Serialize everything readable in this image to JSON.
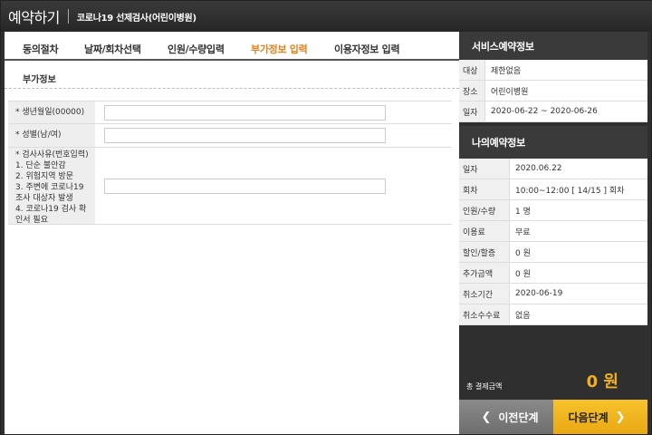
{
  "header": {
    "title": "예약하기",
    "subtitle": "코로나19 선제검사(어린이병원)"
  },
  "tabs": [
    {
      "label": "동의절차",
      "active": false
    },
    {
      "label": "날짜/회차선택",
      "active": false
    },
    {
      "label": "인원/수량입력",
      "active": false
    },
    {
      "label": "부가정보 입력",
      "active": true
    },
    {
      "label": "이용자정보 입력",
      "active": false
    }
  ],
  "section": {
    "title": "부가정보"
  },
  "form": {
    "fields": [
      {
        "label": "* 생년월일(00000)",
        "value": ""
      },
      {
        "label": "* 성별(남/여)",
        "value": ""
      },
      {
        "label": "* 검사사유(번호입력)\n1. 단순 불안감\n2. 위험지역 방문\n3. 주변에 코로나19 조사 대상자 발생\n4. 코로나19 검사 확인서 필요",
        "value": ""
      }
    ]
  },
  "service_info": {
    "heading": "서비스예약정보",
    "rows": [
      {
        "key": "대상",
        "value": "제한없음"
      },
      {
        "key": "장소",
        "value": "어린이병원"
      },
      {
        "key": "일자",
        "value": "2020-06-22 ~ 2020-06-26"
      }
    ]
  },
  "my_info": {
    "heading": "나의예약정보",
    "rows": [
      {
        "key": "일자",
        "value": "2020.06.22"
      },
      {
        "key": "회차",
        "value": "10:00~12:00 [ 14/15 ] 회차"
      },
      {
        "key": "인원/수량",
        "value": "1 명"
      },
      {
        "key": "이용료",
        "value": "무료"
      },
      {
        "key": "할인/할증",
        "value": "0 원"
      },
      {
        "key": "추가금액",
        "value": "0 원"
      },
      {
        "key": "취소기간",
        "value": "2020-06-19"
      },
      {
        "key": "취소수수료",
        "value": "없음"
      }
    ]
  },
  "total": {
    "label": "총 결제금액",
    "amount": "0 원"
  },
  "buttons": {
    "prev": "이전단계",
    "next": "다음단계"
  },
  "icons": {
    "prev": "chevron-left-icon",
    "next": "chevron-right-icon"
  },
  "colors": {
    "accent": "#e8801c",
    "next_button": "#f2b01e",
    "total_amount": "#f2b01e"
  }
}
